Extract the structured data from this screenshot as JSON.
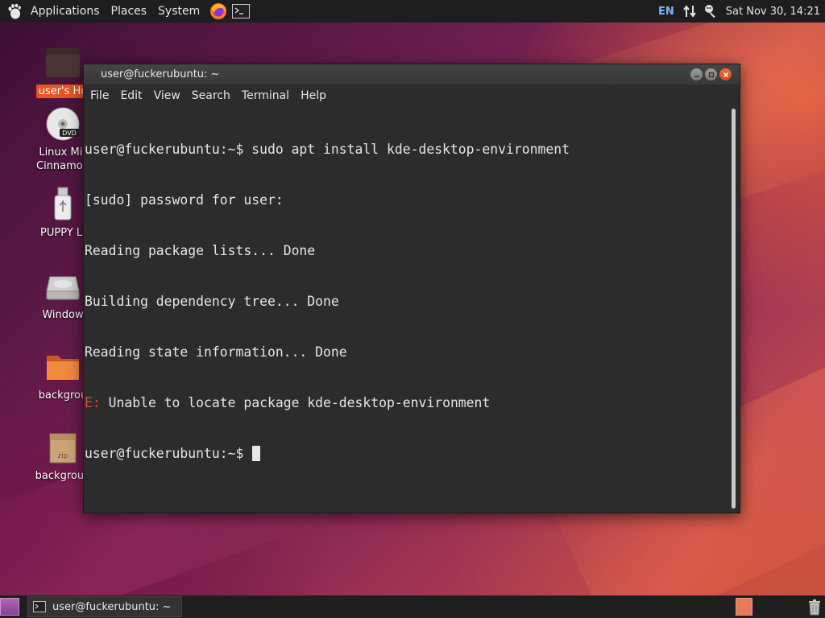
{
  "top_panel": {
    "menus": [
      "Applications",
      "Places",
      "System"
    ],
    "keyboard_layout": "EN",
    "clock": "Sat Nov 30, 14:21"
  },
  "desktop_icons": [
    {
      "label": "user's Ho",
      "icon": "home-folder-icon"
    },
    {
      "label": "Linux Mir\nCinnamon",
      "icon": "dvd-icon"
    },
    {
      "label": "PUPPY LI",
      "icon": "usb-drive-icon"
    },
    {
      "label": "Window",
      "icon": "hard-drive-icon"
    },
    {
      "label": "backgrou",
      "icon": "folder-icon"
    },
    {
      "label": "backgroun",
      "icon": "zip-archive-icon"
    }
  ],
  "terminal": {
    "title": "user@fuckerubuntu: ~",
    "menu": [
      "File",
      "Edit",
      "View",
      "Search",
      "Terminal",
      "Help"
    ],
    "lines": [
      "user@fuckerubuntu:~$ sudo apt install kde-desktop-environment",
      "[sudo] password for user:",
      "Reading package lists... Done",
      "Building dependency tree... Done",
      "Reading state information... Done"
    ],
    "error_prefix": "E:",
    "error_text": " Unable to locate package kde-desktop-environment",
    "prompt": "user@fuckerubuntu:~$ "
  },
  "bottom_panel": {
    "task_label": "user@fuckerubuntu: ~"
  },
  "colors": {
    "accent": "#e95420",
    "error": "#e04a3a",
    "terminal_bg": "#2c2c2c",
    "panel_bg": "#1e1e1e"
  }
}
